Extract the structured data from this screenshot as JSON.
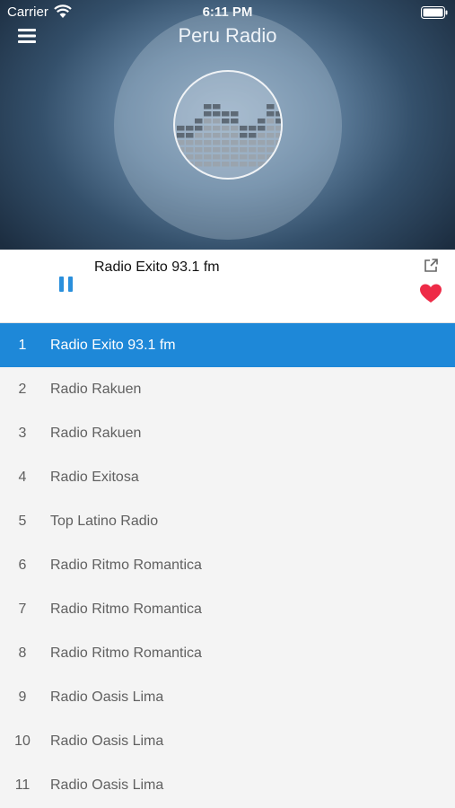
{
  "status_bar": {
    "carrier": "Carrier",
    "time": "6:11 PM",
    "wifi_icon": "wifi-icon",
    "battery_icon": "battery-icon"
  },
  "header": {
    "title": "Peru Radio",
    "menu_icon": "hamburger-menu-icon"
  },
  "artwork": {
    "icon": "equalizer-icon"
  },
  "player": {
    "station": "Radio Exito 93.1 fm",
    "state_icon": "pause-icon",
    "share_icon": "share-icon",
    "favorite_icon": "heart-icon",
    "accent_color": "#2a8fdc",
    "favorite_color": "#ee2b47"
  },
  "stations": [
    {
      "num": "1",
      "name": "Radio Exito 93.1 fm",
      "active": true
    },
    {
      "num": "2",
      "name": "Radio Rakuen"
    },
    {
      "num": "3",
      "name": "Radio Rakuen"
    },
    {
      "num": "4",
      "name": "Radio Exitosa"
    },
    {
      "num": "5",
      "name": "Top Latino Radio"
    },
    {
      "num": "6",
      "name": "Radio Ritmo Romantica"
    },
    {
      "num": "7",
      "name": "Radio Ritmo Romantica"
    },
    {
      "num": "8",
      "name": "Radio Ritmo Romantica"
    },
    {
      "num": "9",
      "name": "Radio Oasis Lima"
    },
    {
      "num": "10",
      "name": "Radio Oasis Lima"
    },
    {
      "num": "11",
      "name": "Radio Oasis Lima"
    }
  ],
  "colors": {
    "active_row": "#1e88d8",
    "list_background": "#f4f4f4"
  }
}
